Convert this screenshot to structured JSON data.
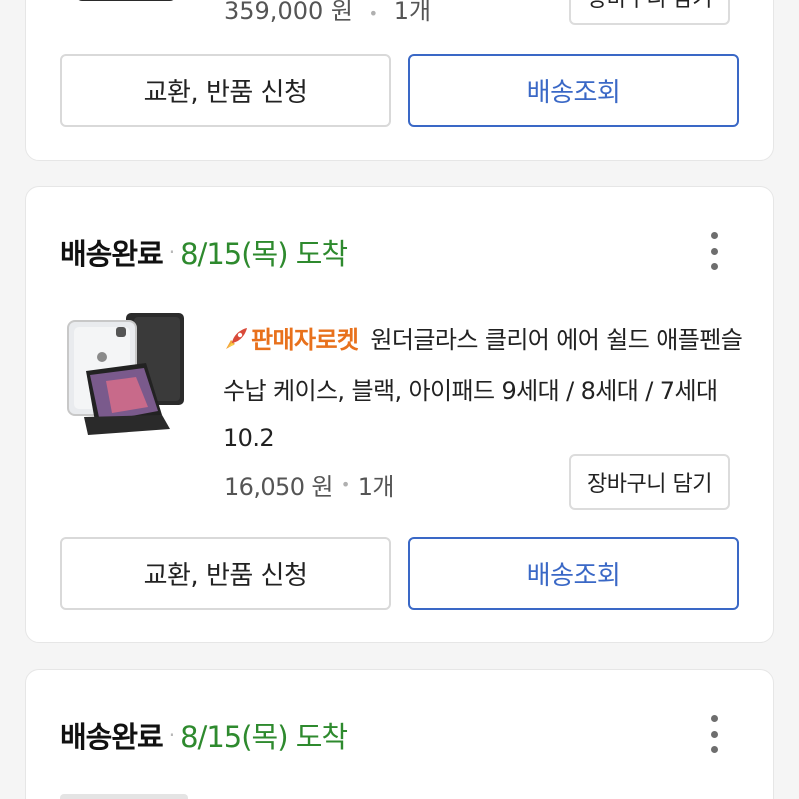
{
  "orders": [
    {
      "price": "359,000 원",
      "quantity": "1개",
      "cart_button": "장바구니 담기",
      "exchange_button": "교환, 반품 신청",
      "track_button": "배송조회"
    },
    {
      "status": "배송완료",
      "separator": "·",
      "arrival": "8/15(목) 도착",
      "seller_badge": "판매자로켓",
      "product_name": "원더글라스 클리어 에어 쉴드 애플펜슬 수납 케이스, 블랙, 아이패드 9세대 / 8세대 / 7세대 10.2",
      "price": "16,050 원",
      "quantity": "1개",
      "cart_button": "장바구니 담기",
      "exchange_button": "교환, 반품 신청",
      "track_button": "배송조회"
    },
    {
      "status": "배송완료",
      "separator": "·",
      "arrival": "8/15(목) 도착"
    }
  ],
  "icons": {
    "more": "more-vertical-icon",
    "rocket": "rocket-icon"
  },
  "colors": {
    "arrival_green": "#2e8a2e",
    "track_blue": "#3a68c6",
    "rocket_orange": "#e8711c"
  }
}
